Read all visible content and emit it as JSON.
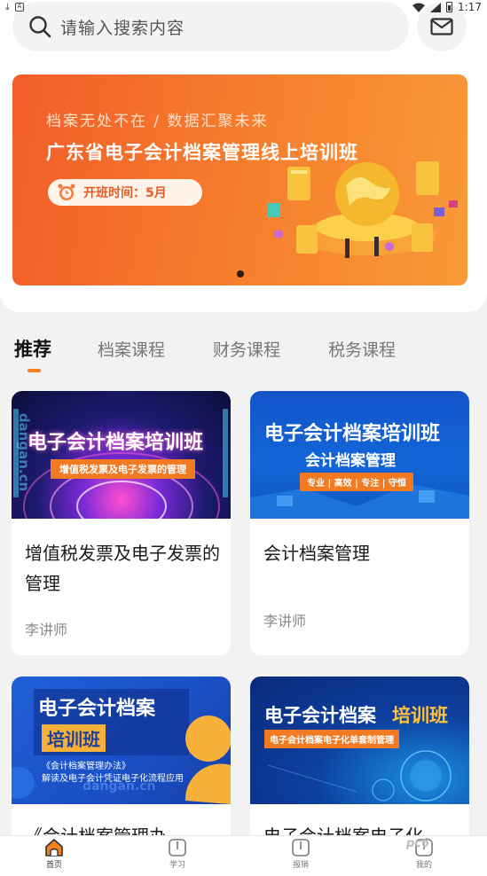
{
  "status_bar": {
    "time": "1:17"
  },
  "search": {
    "placeholder": "请输入搜索内容"
  },
  "banner": {
    "subtitle": "档案无处不在 / 数据汇聚未来",
    "title": "广东省电子会计档案管理线上培训班",
    "pill": "开班时间：5月"
  },
  "tabs": [
    {
      "label": "推荐",
      "active": true
    },
    {
      "label": "档案课程",
      "active": false
    },
    {
      "label": "财务课程",
      "active": false
    },
    {
      "label": "税务课程",
      "active": false
    }
  ],
  "courses": [
    {
      "title": "增值税发票及电子发票的管理",
      "teacher": "李讲师",
      "thumb": {
        "headline": "电子会计档案培训班",
        "sub": "增值税发票及电子发票的管理",
        "watermark": "dangan.cn"
      }
    },
    {
      "title": "会计档案管理",
      "teacher": "李讲师",
      "thumb": {
        "headline": "电子会计档案培训班",
        "sub": "会计档案管理",
        "tags": "专业 | 高效 | 专注 | 守恒"
      }
    },
    {
      "title": "《会计档案管理办",
      "thumb": {
        "headline": "电子会计档案",
        "sub": "培训班",
        "line1": "《会计档案管理办法》",
        "line2": "解读及电子会计凭证电子化流程应用",
        "watermark": "dangan.cn"
      }
    },
    {
      "title": "电子会计档案电子化",
      "thumb": {
        "headline_a": "电子会计档案",
        "headline_b": "培训班",
        "sub": "电子会计档案电子化单套制管理"
      }
    }
  ],
  "bottom_nav": [
    {
      "label": "首页",
      "icon": "home-icon",
      "active": true
    },
    {
      "label": "学习",
      "icon": "book-icon",
      "active": false
    },
    {
      "label": "报销",
      "icon": "receipt-icon",
      "active": false
    },
    {
      "label": "我的",
      "icon": "user-icon",
      "active": false
    }
  ],
  "watermark": "pc6",
  "colors": {
    "accent": "#f58220",
    "banner_start": "#f25d2a",
    "banner_end": "#f99a38"
  }
}
